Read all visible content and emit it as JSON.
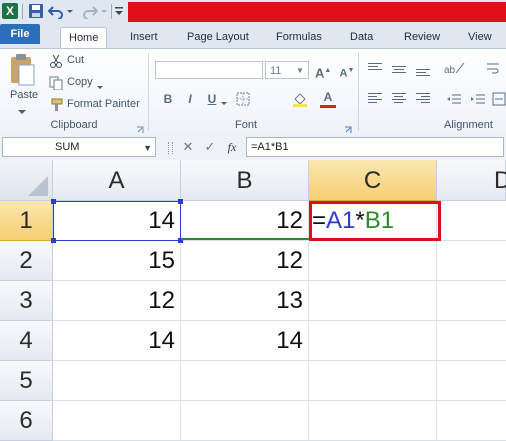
{
  "qat": {
    "logo": "X"
  },
  "tabs": [
    "File",
    "Home",
    "Insert",
    "Page Layout",
    "Formulas",
    "Data",
    "Review",
    "View"
  ],
  "ribbon": {
    "clipboard": {
      "paste": "Paste",
      "cut": "Cut",
      "copy": "Copy",
      "format_painter": "Format Painter",
      "label": "Clipboard"
    },
    "font": {
      "size": "11",
      "label": "Font",
      "bold": "B",
      "italic": "I",
      "underline": "U"
    },
    "alignment": {
      "label": "Alignment"
    }
  },
  "formula_bar": {
    "name_box": "SUM",
    "cancel": "✕",
    "enter": "✓",
    "fx": "fx",
    "formula": "=A1*B1"
  },
  "grid": {
    "columns": [
      "A",
      "B",
      "C",
      "D"
    ],
    "rows": [
      "1",
      "2",
      "3",
      "4",
      "5",
      "6"
    ],
    "cells": {
      "A1": "14",
      "B1": "12",
      "A2": "15",
      "B2": "12",
      "A3": "12",
      "B3": "13",
      "A4": "14",
      "B4": "14"
    },
    "editing_cell": {
      "eq": "=",
      "ref1": "A1",
      "op": "*",
      "ref2": "B1"
    }
  },
  "colors": {
    "accent_red": "#e0101a",
    "ref_blue": "#2a3cd1",
    "ref_green": "#2c8a2c",
    "file_tab": "#2a6fba"
  }
}
